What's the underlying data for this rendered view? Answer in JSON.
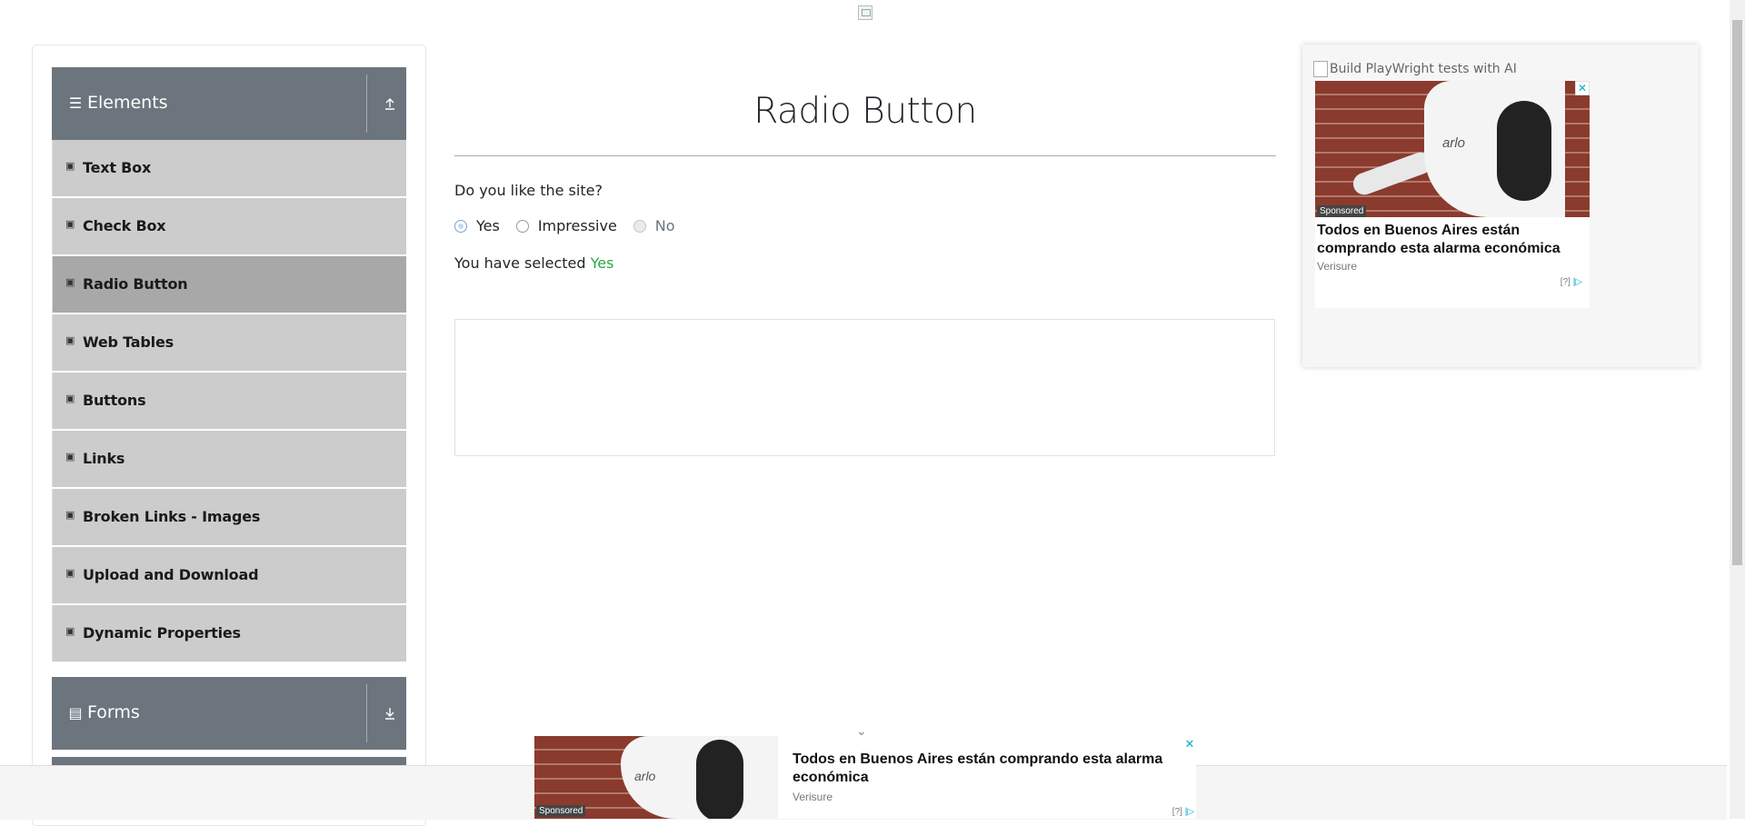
{
  "header": {
    "logo_alt": ""
  },
  "sidebar": {
    "groups": [
      {
        "title": "Elements",
        "icon": "hamburger-icon",
        "toggle_icon": "collapse-up-icon"
      },
      {
        "title": "Forms",
        "icon": "document-icon",
        "toggle_icon": "expand-down-icon"
      }
    ],
    "items": [
      {
        "label": "Text Box"
      },
      {
        "label": "Check Box"
      },
      {
        "label": "Radio Button"
      },
      {
        "label": "Web Tables"
      },
      {
        "label": "Buttons"
      },
      {
        "label": "Links"
      },
      {
        "label": "Broken Links - Images"
      },
      {
        "label": "Upload and Download"
      },
      {
        "label": "Dynamic Properties"
      }
    ],
    "active_item": "Radio Button"
  },
  "main": {
    "title": "Radio Button",
    "question": "Do you like the site?",
    "options": [
      {
        "label": "Yes",
        "checked": true,
        "disabled": false
      },
      {
        "label": "Impressive",
        "checked": false,
        "disabled": false
      },
      {
        "label": "No",
        "checked": false,
        "disabled": true
      }
    ],
    "selected_prefix": "You have selected ",
    "selected_value": "Yes"
  },
  "ad_right": {
    "alt_text": "Build PlayWright tests with AI",
    "sponsored": "Sponsored",
    "brand": "arlo",
    "headline": "Todos en Buenos Aires están comprando esta alarma económica",
    "advertiser": "Verisure",
    "choices": "[?]",
    "close": "✕"
  },
  "ad_bottom": {
    "sponsored": "Sponsored",
    "brand": "arlo",
    "headline": "Todos en Buenos Aires están comprando esta alarma económica",
    "advertiser": "Verisure",
    "choices": "[?]",
    "close": "✕",
    "chevron": "⌄"
  },
  "colors": {
    "accent_green": "#28a745",
    "header_gray": "#6c757d",
    "menu_gray": "#cccccc",
    "active_gray": "#a8a8a8",
    "ad_blue": "#00aecd"
  }
}
